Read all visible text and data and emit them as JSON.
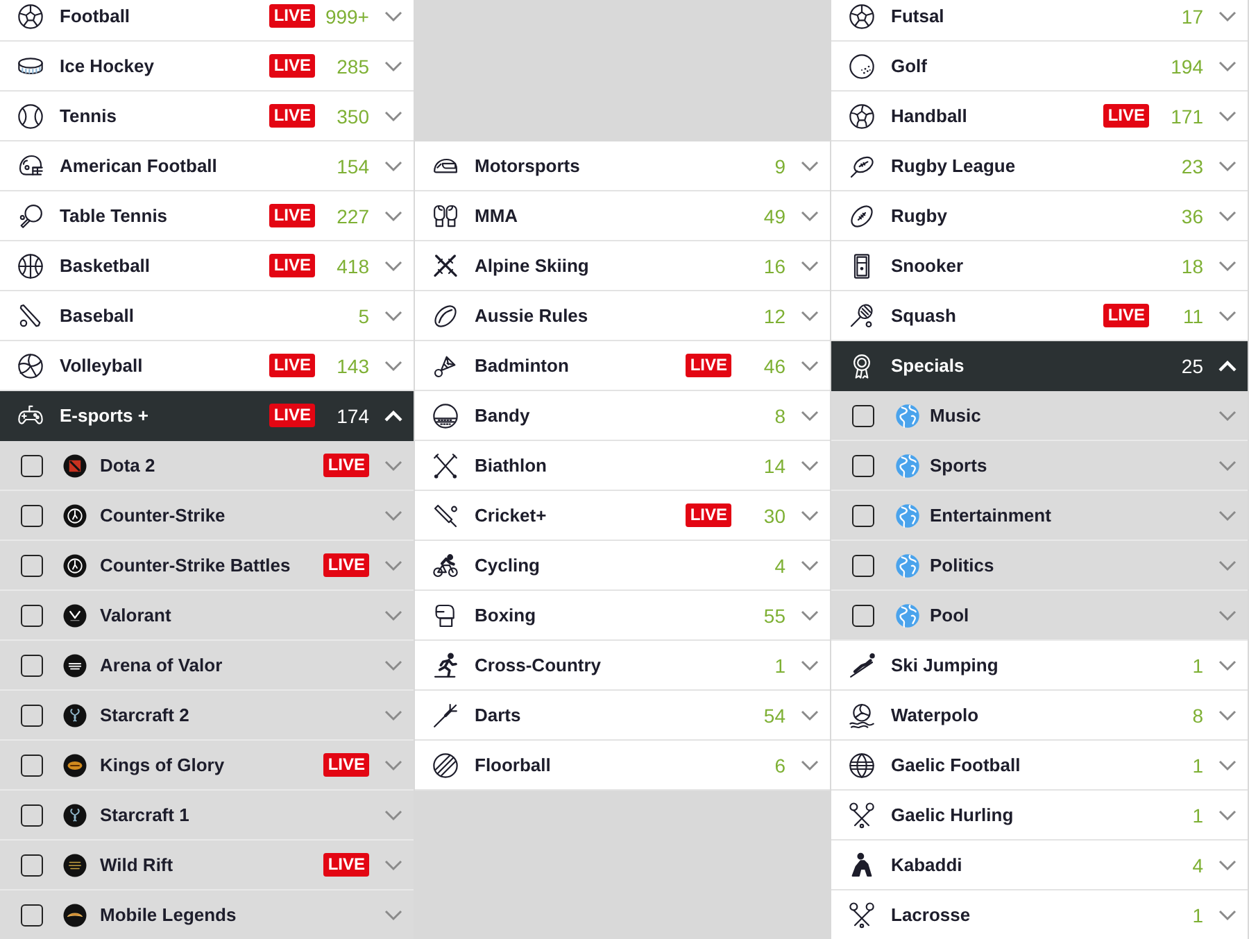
{
  "columns": [
    {
      "items": [
        {
          "label": "Football",
          "badge": "LIVE",
          "count": "999+",
          "expanded": false
        },
        {
          "label": "Ice Hockey",
          "badge": "LIVE",
          "count": "285",
          "expanded": false
        },
        {
          "label": "Tennis",
          "badge": "LIVE",
          "count": "350",
          "expanded": false
        },
        {
          "label": "American Football",
          "count": "154",
          "expanded": false
        },
        {
          "label": "Table Tennis",
          "badge": "LIVE",
          "count": "227",
          "expanded": false
        },
        {
          "label": "Basketball",
          "badge": "LIVE",
          "count": "418",
          "expanded": false
        },
        {
          "label": "Baseball",
          "count": "5",
          "expanded": false
        },
        {
          "label": "Volleyball",
          "badge": "LIVE",
          "count": "143",
          "expanded": false
        },
        {
          "label": "E-sports +",
          "badge": "LIVE",
          "count": "174",
          "expanded": true,
          "children": [
            {
              "label": "Dota 2",
              "badge": "LIVE",
              "checked": false,
              "expanded": false
            },
            {
              "label": "Counter-Strike",
              "checked": false,
              "expanded": false
            },
            {
              "label": "Counter-Strike Battles",
              "badge": "LIVE",
              "checked": false,
              "expanded": false
            },
            {
              "label": "Valorant",
              "checked": false,
              "expanded": false
            },
            {
              "label": "Arena of Valor",
              "checked": false,
              "expanded": false
            },
            {
              "label": "Starcraft 2",
              "checked": false,
              "expanded": false
            },
            {
              "label": "Kings of Glory",
              "badge": "LIVE",
              "checked": false,
              "expanded": false
            },
            {
              "label": "Starcraft 1",
              "checked": false,
              "expanded": false
            },
            {
              "label": "Wild Rift",
              "badge": "LIVE",
              "checked": false,
              "expanded": false
            },
            {
              "label": "Mobile Legends",
              "checked": false,
              "expanded": false
            }
          ]
        }
      ]
    },
    {
      "items": [
        {
          "label": "Motorsports",
          "count": "9",
          "expanded": false
        },
        {
          "label": "MMA",
          "count": "49",
          "expanded": false
        },
        {
          "label": "Alpine Skiing",
          "count": "16",
          "expanded": false
        },
        {
          "label": "Aussie Rules",
          "count": "12",
          "expanded": false
        },
        {
          "label": "Badminton",
          "badge": "LIVE",
          "count": "46",
          "expanded": false
        },
        {
          "label": "Bandy",
          "count": "8",
          "expanded": false
        },
        {
          "label": "Biathlon",
          "count": "14",
          "expanded": false
        },
        {
          "label": "Cricket+",
          "badge": "LIVE",
          "count": "30",
          "expanded": false
        },
        {
          "label": "Cycling",
          "count": "4",
          "expanded": false
        },
        {
          "label": "Boxing",
          "count": "55",
          "expanded": false
        },
        {
          "label": "Cross-Country",
          "count": "1",
          "expanded": false
        },
        {
          "label": "Darts",
          "count": "54",
          "expanded": false
        },
        {
          "label": "Floorball",
          "count": "6",
          "expanded": false
        }
      ]
    },
    {
      "items": [
        {
          "label": "Futsal",
          "count": "17",
          "expanded": false
        },
        {
          "label": "Golf",
          "count": "194",
          "expanded": false
        },
        {
          "label": "Handball",
          "badge": "LIVE",
          "count": "171",
          "expanded": false
        },
        {
          "label": "Rugby League",
          "count": "23",
          "expanded": false
        },
        {
          "label": "Rugby",
          "count": "36",
          "expanded": false
        },
        {
          "label": "Snooker",
          "count": "18",
          "expanded": false
        },
        {
          "label": "Squash",
          "badge": "LIVE",
          "count": "11",
          "expanded": false
        },
        {
          "label": "Specials",
          "count": "25",
          "expanded": true,
          "children": [
            {
              "label": "Music",
              "checked": false,
              "expanded": false
            },
            {
              "label": "Sports",
              "checked": false,
              "expanded": false
            },
            {
              "label": "Entertainment",
              "checked": false,
              "expanded": false
            },
            {
              "label": "Politics",
              "checked": false,
              "expanded": false
            },
            {
              "label": "Pool",
              "checked": false,
              "expanded": false
            }
          ]
        },
        {
          "label": "Ski Jumping",
          "count": "1",
          "expanded": false
        },
        {
          "label": "Waterpolo",
          "count": "8",
          "expanded": false
        },
        {
          "label": "Gaelic Football",
          "count": "1",
          "expanded": false
        },
        {
          "label": "Gaelic Hurling",
          "count": "1",
          "expanded": false
        },
        {
          "label": "Kabaddi",
          "count": "4",
          "expanded": false
        },
        {
          "label": "Lacrosse",
          "count": "1",
          "expanded": false
        }
      ]
    }
  ]
}
